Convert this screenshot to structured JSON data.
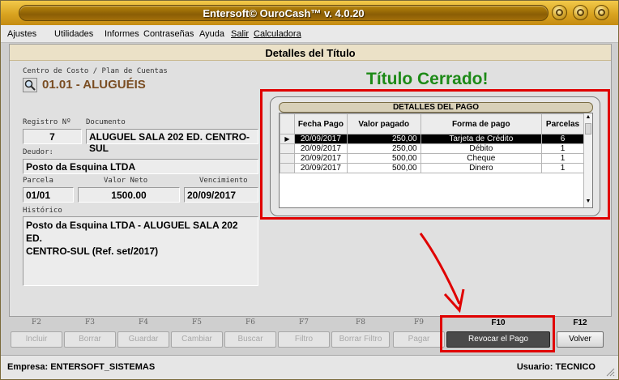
{
  "window": {
    "title": "Entersoft© OuroCash™ v. 4.0.20"
  },
  "menu": [
    "Ajustes",
    "Utilidades",
    "Informes",
    "Contraseñas",
    "Ayuda",
    "Salir",
    "Calculadora"
  ],
  "header": {
    "title": "Detalles del Título"
  },
  "account": {
    "label": "Centro de Costo / Plan de Cuentas",
    "value": "01.01 - ALUGUÉIS"
  },
  "status_title": "Título Cerrado!",
  "form": {
    "registro_label": "Registro Nº",
    "registro": "7",
    "documento_label": "Documento",
    "documento": "ALUGUEL SALA 202 ED. CENTRO-SUL",
    "deudor_label": "Deudor:",
    "deudor": "Posto da Esquina LTDA",
    "parcela_label": "Parcela",
    "parcela": "01/01",
    "valor_neto_label": "Valor Neto",
    "valor_neto": "1500.00",
    "vencimiento_label": "Vencimiento",
    "vencimiento": "20/09/2017",
    "historico_label": "Histórico",
    "historico_line1": "Posto da Esquina LTDA - ALUGUEL SALA 202 ED.",
    "historico_line2": "CENTRO-SUL (Ref. set/2017)"
  },
  "payments": {
    "title": "DETALLES DEL PAGO",
    "columns": [
      "Fecha Pago",
      "Valor pagado",
      "Forma de pago",
      "Parcelas"
    ],
    "rows": [
      [
        "20/09/2017",
        "250,00",
        "Tarjeta de Crédito",
        "6"
      ],
      [
        "20/09/2017",
        "250,00",
        "Débito",
        "1"
      ],
      [
        "20/09/2017",
        "500,00",
        "Cheque",
        "1"
      ],
      [
        "20/09/2017",
        "500,00",
        "Dinero",
        "1"
      ]
    ]
  },
  "fkeys": [
    {
      "key": "F2",
      "label": "Incluir"
    },
    {
      "key": "F3",
      "label": "Borrar"
    },
    {
      "key": "F4",
      "label": "Guardar"
    },
    {
      "key": "F5",
      "label": "Cambiar"
    },
    {
      "key": "F6",
      "label": "Buscar"
    },
    {
      "key": "F7",
      "label": "Filtro"
    },
    {
      "key": "F8",
      "label": "Borrar Filtro"
    },
    {
      "key": "F9",
      "label": "Pagar"
    },
    {
      "key": "F10",
      "label": "Revocar el Pago"
    },
    {
      "key": "F12",
      "label": "Volver"
    }
  ],
  "status": {
    "empresa": "Empresa: ENTERSOFT_SISTEMAS",
    "usuario": "Usuario: TECNICO"
  },
  "colors": {
    "title_bar": "#d9a320",
    "closed_green": "#1d8a17",
    "highlight_red": "#e00000"
  }
}
